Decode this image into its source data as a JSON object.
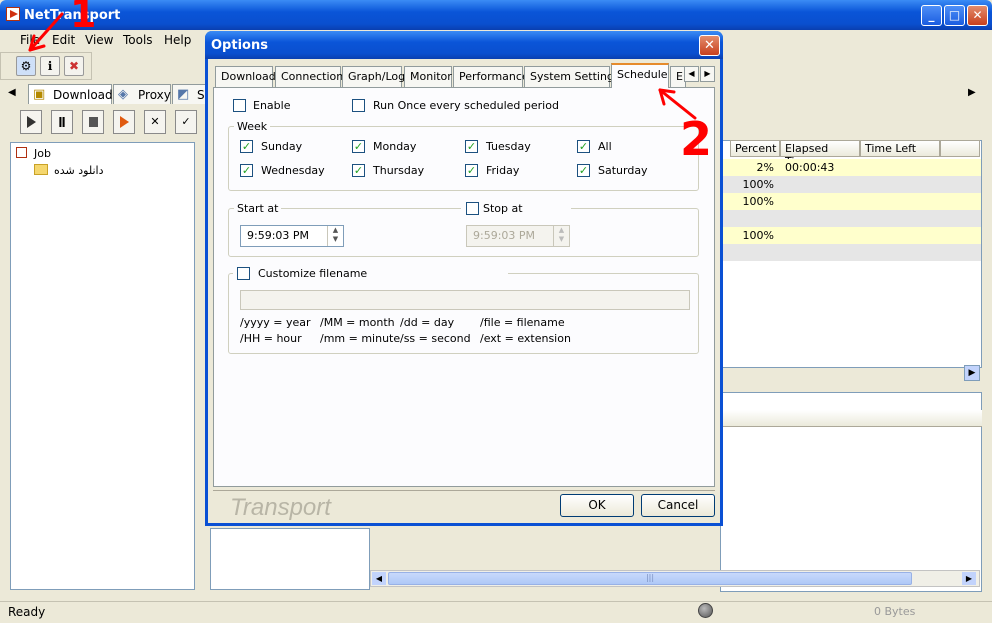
{
  "app": {
    "title": "NetTransport"
  },
  "menu": [
    "File",
    "Edit",
    "View",
    "Tools",
    "Help"
  ],
  "main_tabs": [
    "Download",
    "Proxy",
    "S"
  ],
  "tree": {
    "root": "Job",
    "child": "دانلود شده"
  },
  "grid": {
    "headers": [
      "Percent",
      "Elapsed Time",
      "Time Left"
    ],
    "rows": [
      {
        "percent": "2%",
        "elapsed": "00:00:43",
        "left": ""
      },
      {
        "percent": "100%",
        "elapsed": "",
        "left": ""
      },
      {
        "percent": "100%",
        "elapsed": "",
        "left": ""
      },
      {
        "percent": "",
        "elapsed": "",
        "left": ""
      },
      {
        "percent": "100%",
        "elapsed": "",
        "left": ""
      },
      {
        "percent": "",
        "elapsed": "",
        "left": ""
      }
    ]
  },
  "status": {
    "text": "Ready",
    "bytes": "0 Bytes"
  },
  "dialog": {
    "title": "Options",
    "tabs": [
      "Download",
      "Connection",
      "Graph/Log",
      "Monitor",
      "Performance",
      "System Settings",
      "Schedule",
      "E"
    ],
    "enable": "Enable",
    "run_once": "Run Once every scheduled period",
    "week_label": "Week",
    "days": [
      {
        "label": "Sunday",
        "checked": true
      },
      {
        "label": "Monday",
        "checked": true
      },
      {
        "label": "Tuesday",
        "checked": true
      },
      {
        "label": "All",
        "checked": true
      },
      {
        "label": "Wednesday",
        "checked": true
      },
      {
        "label": "Thursday",
        "checked": true
      },
      {
        "label": "Friday",
        "checked": true
      },
      {
        "label": "Saturday",
        "checked": true
      }
    ],
    "start_at_label": "Start at",
    "start_time": "9:59:03 PM",
    "stop_at_label": "Stop at",
    "stop_time": "9:59:03 PM",
    "customize_label": "Customize filename",
    "filename_value": "",
    "legend": [
      "/yyyy = year",
      "/MM = month",
      "/dd = day",
      "/file = filename",
      "/HH = hour",
      "/mm = minute",
      "/ss = second",
      "/ext = extension"
    ],
    "watermark": "Transport",
    "ok": "OK",
    "cancel": "Cancel"
  },
  "annotations": {
    "one": "1",
    "two": "2"
  },
  "colors": {
    "titlebar": "#0a55d8",
    "highlight_row": "#ffffcc",
    "grey_row": "#e6e6e6",
    "annotation": "#ff0000"
  }
}
